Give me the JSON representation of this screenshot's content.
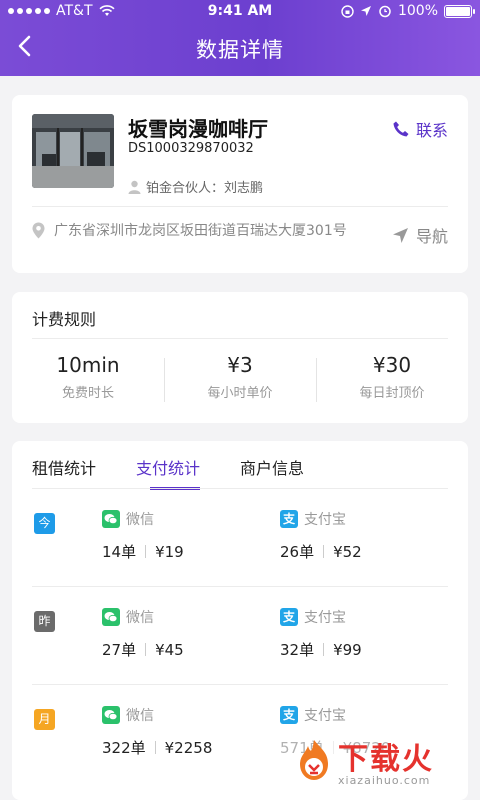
{
  "status_bar": {
    "carrier": "AT&T",
    "time": "9:41 AM",
    "battery": "100%"
  },
  "header": {
    "title": "数据详情"
  },
  "store": {
    "name": "坂雪岗漫咖啡厅",
    "id": "DS1000329870032",
    "partner": "铂金合伙人：刘志鹏",
    "contact_label": "联系",
    "address": "广东省深圳市龙岗区坂田街道百瑞达大厦301号",
    "nav_label": "导航"
  },
  "fees": {
    "title": "计费规则",
    "items": [
      {
        "value": "10min",
        "label": "免费时长"
      },
      {
        "value": "¥3",
        "label": "每小时单价"
      },
      {
        "value": "¥30",
        "label": "每日封顶价"
      }
    ]
  },
  "tabs": [
    {
      "label": "租借统计",
      "active": false
    },
    {
      "label": "支付统计",
      "active": true
    },
    {
      "label": "商户信息",
      "active": false
    }
  ],
  "stats": [
    {
      "badge": "今",
      "badge_color": "#1e9be8",
      "wechat": {
        "label": "微信",
        "orders": "14单",
        "amount": "¥19"
      },
      "alipay": {
        "label": "支付宝",
        "orders": "26单",
        "amount": "¥52"
      }
    },
    {
      "badge": "昨",
      "badge_color": "#6b6b6b",
      "wechat": {
        "label": "微信",
        "orders": "27单",
        "amount": "¥45"
      },
      "alipay": {
        "label": "支付宝",
        "orders": "32单",
        "amount": "¥99"
      }
    },
    {
      "badge": "月",
      "badge_color": "#f5a623",
      "wechat": {
        "label": "微信",
        "orders": "322单",
        "amount": "¥2258"
      },
      "alipay": {
        "label": "支付宝",
        "orders": "571单",
        "amount": "¥8720"
      }
    }
  ],
  "watermark": {
    "text": "下载火",
    "url": "xiazaihuo.com"
  },
  "colors": {
    "accent": "#5a33c9",
    "header_start": "#7b4cd6",
    "header_end": "#8a56e0",
    "wechat": "#2bc16b",
    "alipay": "#21a5e8"
  }
}
